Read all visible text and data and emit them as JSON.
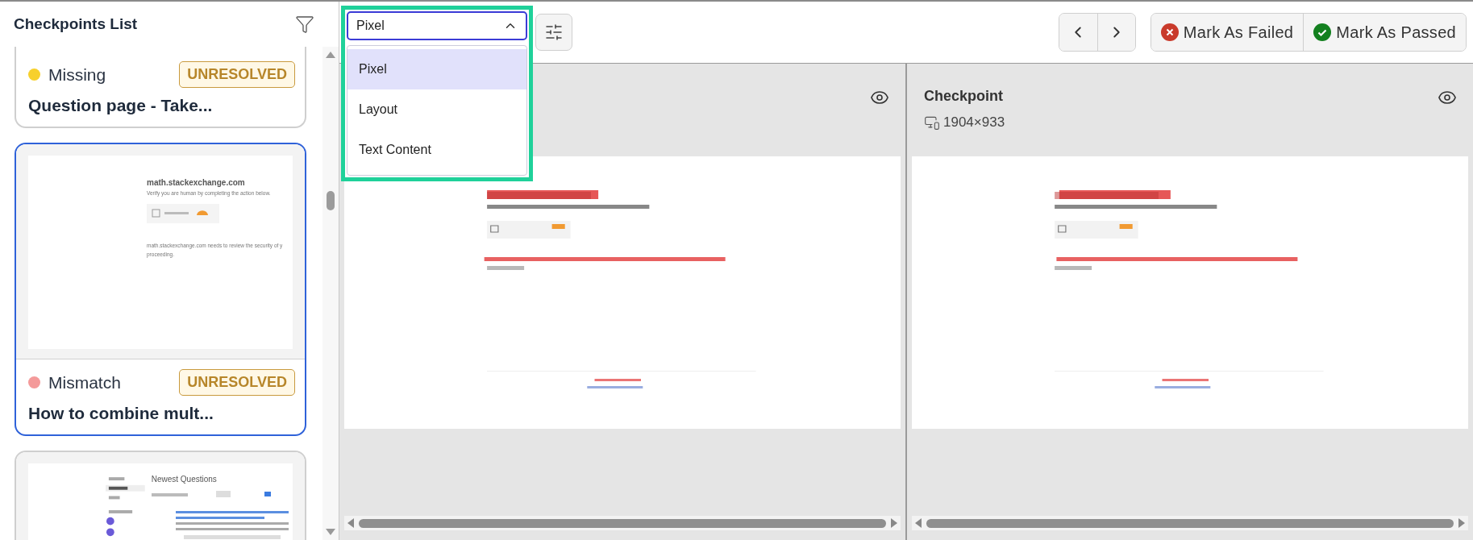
{
  "sidebar": {
    "title": "Checkpoints List",
    "cards": [
      {
        "status": "Missing",
        "color": "#f7d02c",
        "badge": "UNRESOLVED",
        "title": "Question page - Take...",
        "selected": false
      },
      {
        "status": "Mismatch",
        "color": "#f49a9a",
        "badge": "UNRESOLVED",
        "title": "How to combine mult...",
        "selected": true,
        "preview": {
          "kind": "verify",
          "heading": "math.stackexchange.com",
          "lines": [
            "Verify you are human by completing the action below.",
            "math.stackexchange.com needs to review the security of y",
            "proceeding."
          ]
        }
      },
      {
        "selected": false,
        "preview": {
          "kind": "questions",
          "heading": "Newest Questions"
        }
      }
    ]
  },
  "comparison_mode": {
    "value": "Pixel",
    "expanded": true,
    "options": [
      {
        "label": "Pixel",
        "selected": true
      },
      {
        "label": "Layout",
        "selected": false
      },
      {
        "label": "Text Content",
        "selected": false
      }
    ]
  },
  "actions": [
    {
      "label": "Mark As Failed",
      "kind": "fail"
    },
    {
      "label": "Mark As Passed",
      "kind": "pass"
    }
  ],
  "panes": [
    {
      "kind": "baseline"
    },
    {
      "kind": "checkpoint",
      "title": "Checkpoint",
      "viewport": "1904×933"
    }
  ]
}
